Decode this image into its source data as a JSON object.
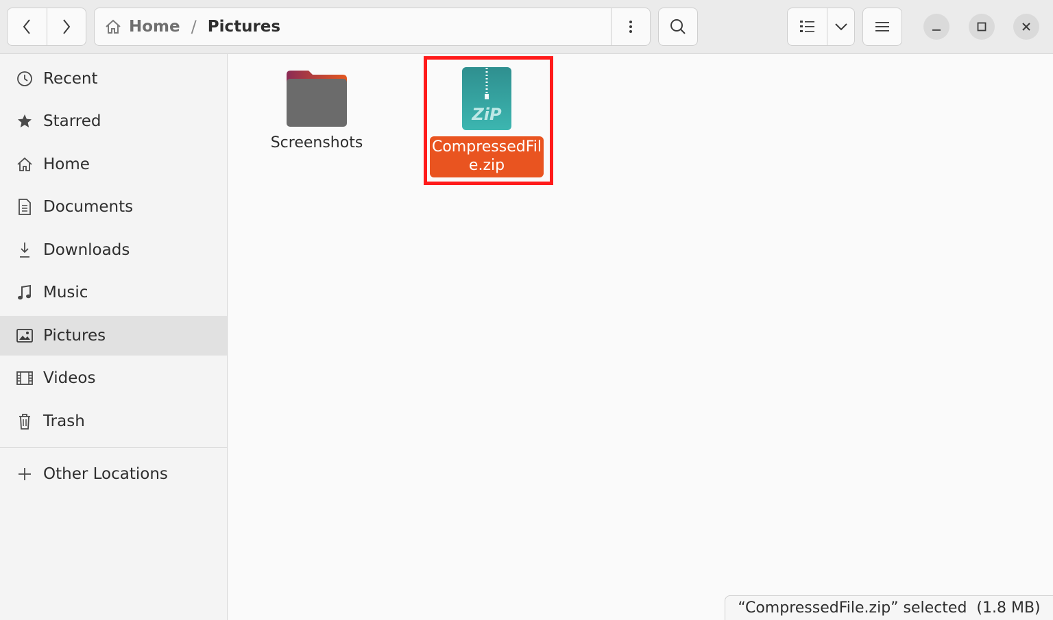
{
  "header": {
    "breadcrumb": {
      "home_label": "Home",
      "separator": "/",
      "current_label": "Pictures"
    }
  },
  "sidebar": {
    "items": [
      {
        "label": "Recent",
        "icon": "clock-icon"
      },
      {
        "label": "Starred",
        "icon": "star-icon"
      },
      {
        "label": "Home",
        "icon": "home-icon"
      },
      {
        "label": "Documents",
        "icon": "document-icon"
      },
      {
        "label": "Downloads",
        "icon": "download-icon"
      },
      {
        "label": "Music",
        "icon": "music-note-icon"
      },
      {
        "label": "Pictures",
        "icon": "picture-icon",
        "active": true
      },
      {
        "label": "Videos",
        "icon": "film-icon"
      },
      {
        "label": "Trash",
        "icon": "trash-icon"
      }
    ],
    "other_locations": {
      "label": "Other Locations",
      "icon": "plus-icon"
    }
  },
  "files": [
    {
      "name": "Screenshots",
      "type": "folder"
    },
    {
      "name": "CompressedFile.zip",
      "type": "zip",
      "icon_text": "ZiP",
      "selected": true
    }
  ],
  "status_bar": {
    "text": "“CompressedFile.zip” selected  (1.8 MB)"
  },
  "colors": {
    "selection": "#e95420",
    "highlight_border": "#ff1a1a",
    "zip_icon": "#2a9d9d"
  }
}
